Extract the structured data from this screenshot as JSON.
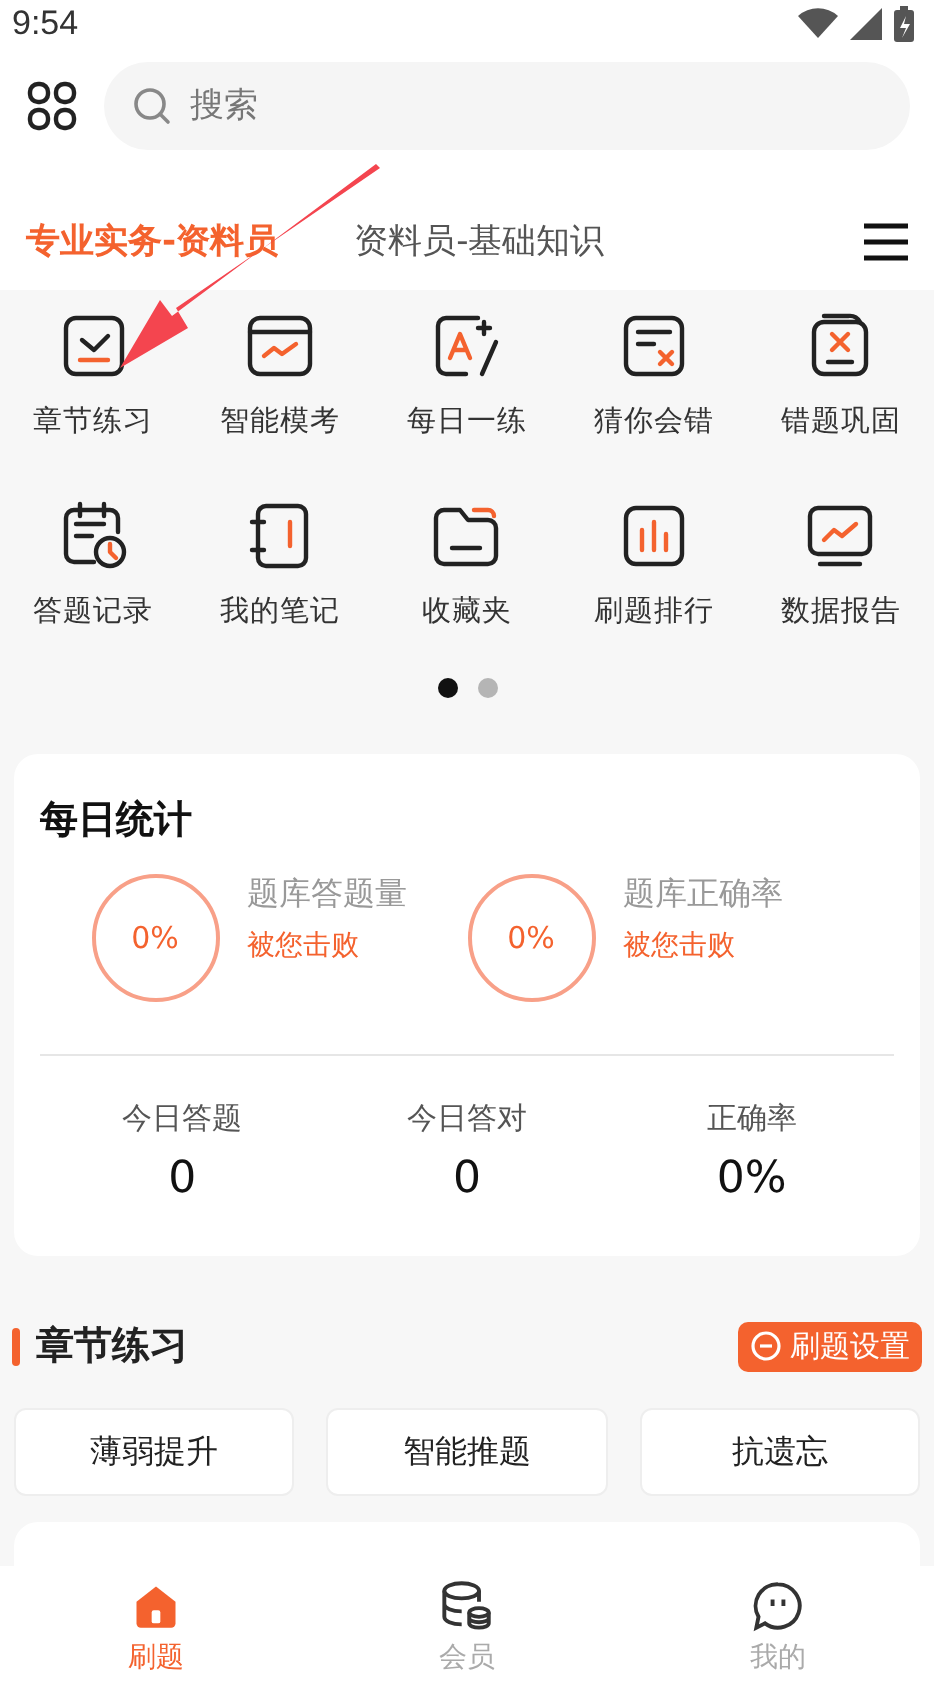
{
  "status_bar": {
    "time": "9:54"
  },
  "search": {
    "placeholder": "搜索"
  },
  "tabs": [
    {
      "label": "专业实务-资料员",
      "selected": true
    },
    {
      "label": "资料员-基础知识",
      "selected": false
    }
  ],
  "shortcuts": [
    {
      "label": "章节练习"
    },
    {
      "label": "智能模考"
    },
    {
      "label": "每日一练"
    },
    {
      "label": "猜你会错"
    },
    {
      "label": "错题巩固"
    },
    {
      "label": "答题记录"
    },
    {
      "label": "我的笔记"
    },
    {
      "label": "收藏夹"
    },
    {
      "label": "刷题排行"
    },
    {
      "label": "数据报告"
    }
  ],
  "pager": [
    {
      "selected": true
    },
    {
      "selected": false
    }
  ],
  "daily_stats": {
    "title": "每日统计",
    "rings": [
      {
        "value": "0%",
        "label": "题库答题量",
        "note": "被您击败"
      },
      {
        "value": "0%",
        "label": "题库正确率",
        "note": "被您击败"
      }
    ],
    "totals": [
      {
        "label": "今日答题",
        "value": "0"
      },
      {
        "label": "今日答对",
        "value": "0"
      },
      {
        "label": "正确率",
        "value": "0%"
      }
    ]
  },
  "chapter_practice": {
    "title": "章节练习",
    "settings_button": "刷题设置",
    "modes": [
      "薄弱提升",
      "智能推题",
      "抗遗忘"
    ]
  },
  "bottom_nav": [
    {
      "label": "刷题",
      "selected": true
    },
    {
      "label": "会员",
      "selected": false
    },
    {
      "label": "我的",
      "selected": false
    }
  ]
}
